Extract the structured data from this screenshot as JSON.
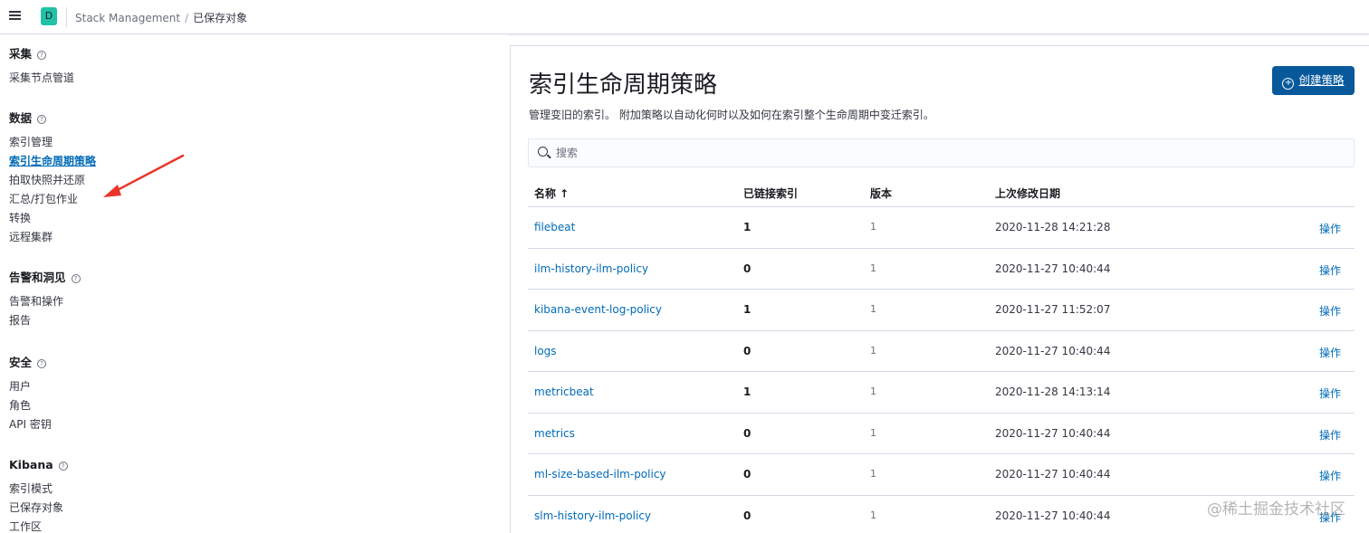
{
  "header": {
    "space_initial": "D",
    "breadcrumb": [
      "Stack Management",
      "已保存对象"
    ]
  },
  "sidebar": {
    "groups": [
      {
        "title": "采集",
        "items": [
          "采集节点管道"
        ]
      },
      {
        "title": "数据",
        "items": [
          "索引管理",
          "索引生命周期策略",
          "拍取快照并还原",
          "汇总/打包作业",
          "转换",
          "远程集群"
        ]
      },
      {
        "title": "告警和洞见",
        "items": [
          "告警和操作",
          "报告"
        ]
      },
      {
        "title": "安全",
        "items": [
          "用户",
          "角色",
          "API 密钥"
        ]
      },
      {
        "title": "Kibana",
        "items": [
          "索引模式",
          "已保存对象",
          "工作区"
        ]
      }
    ],
    "active_item": "索引生命周期策略"
  },
  "main": {
    "title": "索引生命周期策略",
    "description": "管理变旧的索引。 附加策略以自动化何时以及如何在索引整个生命周期中变迁索引。",
    "create_button": "创建策略",
    "search_placeholder": "搜索",
    "columns": [
      "名称 ↑",
      "已链接索引",
      "版本",
      "上次修改日期"
    ],
    "rows": [
      {
        "name": "filebeat",
        "linked": "1",
        "version": "1",
        "modified": "2020-11-28 14:21:28",
        "action": "操作"
      },
      {
        "name": "ilm-history-ilm-policy",
        "linked": "0",
        "version": "1",
        "modified": "2020-11-27 10:40:44",
        "action": "操作"
      },
      {
        "name": "kibana-event-log-policy",
        "linked": "1",
        "version": "1",
        "modified": "2020-11-27 11:52:07",
        "action": "操作"
      },
      {
        "name": "logs",
        "linked": "0",
        "version": "1",
        "modified": "2020-11-27 10:40:44",
        "action": "操作"
      },
      {
        "name": "metricbeat",
        "linked": "1",
        "version": "1",
        "modified": "2020-11-28 14:13:14",
        "action": "操作"
      },
      {
        "name": "metrics",
        "linked": "0",
        "version": "1",
        "modified": "2020-11-27 10:40:44",
        "action": "操作"
      },
      {
        "name": "ml-size-based-ilm-policy",
        "linked": "0",
        "version": "1",
        "modified": "2020-11-27 10:40:44",
        "action": "操作"
      },
      {
        "name": "slm-history-ilm-policy",
        "linked": "0",
        "version": "1",
        "modified": "2020-11-27 10:40:44",
        "action": "操作"
      }
    ]
  },
  "watermark": "@稀土掘金技术社区",
  "colors": {
    "accent": "#006bb8",
    "primary_button": "#07599c",
    "space_badge": "#20c2a6",
    "annotation_arrow": "#e8352b"
  }
}
